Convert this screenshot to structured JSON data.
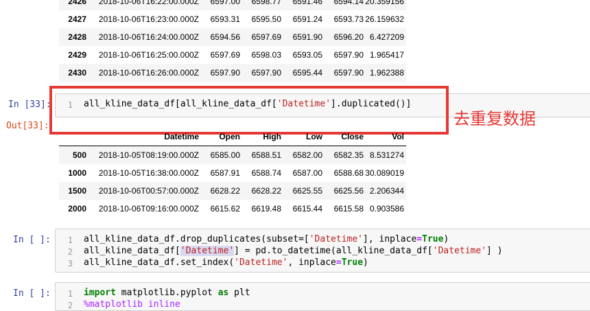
{
  "top_table": {
    "rows": [
      {
        "idx": "2426",
        "datetime": "2018-10-06T16:22:00.000Z",
        "open": "6597.00",
        "high": "6598.77",
        "low": "6591.46",
        "close": "6594.14",
        "vol": "20.359156"
      },
      {
        "idx": "2427",
        "datetime": "2018-10-06T16:23:00.000Z",
        "open": "6593.31",
        "high": "6595.50",
        "low": "6591.24",
        "close": "6593.73",
        "vol": "26.159632"
      },
      {
        "idx": "2428",
        "datetime": "2018-10-06T16:24:00.000Z",
        "open": "6594.56",
        "high": "6597.69",
        "low": "6591.90",
        "close": "6596.20",
        "vol": "6.427209"
      },
      {
        "idx": "2429",
        "datetime": "2018-10-06T16:25:00.000Z",
        "open": "6597.69",
        "high": "6598.03",
        "low": "6593.05",
        "close": "6597.90",
        "vol": "1.965417"
      },
      {
        "idx": "2430",
        "datetime": "2018-10-06T16:26:00.000Z",
        "open": "6597.90",
        "high": "6597.90",
        "low": "6595.44",
        "close": "6597.90",
        "vol": "1.962388"
      }
    ]
  },
  "cell33": {
    "prompt_in": "In [33]:",
    "prompt_out": "Out[33]:",
    "line_no": "1",
    "code_pre": "all_kline_data_df[all_kline_data_df[",
    "code_str": "'Datetime'",
    "code_post": "].duplicated()]",
    "annotation": "去重复数据"
  },
  "out_table": {
    "headers": [
      "Datetime",
      "Open",
      "High",
      "Low",
      "Close",
      "Vol"
    ],
    "rows": [
      {
        "idx": "500",
        "datetime": "2018-10-05T08:19:00.000Z",
        "open": "6585.00",
        "high": "6588.51",
        "low": "6582.00",
        "close": "6582.35",
        "vol": "8.531274"
      },
      {
        "idx": "1000",
        "datetime": "2018-10-05T16:38:00.000Z",
        "open": "6587.91",
        "high": "6588.74",
        "low": "6587.00",
        "close": "6588.68",
        "vol": "30.089019"
      },
      {
        "idx": "1500",
        "datetime": "2018-10-06T00:57:00.000Z",
        "open": "6628.22",
        "high": "6628.22",
        "low": "6625.55",
        "close": "6625.56",
        "vol": "2.206344"
      },
      {
        "idx": "2000",
        "datetime": "2018-10-06T09:16:00.000Z",
        "open": "6615.62",
        "high": "6619.48",
        "low": "6615.44",
        "close": "6615.58",
        "vol": "0.903586"
      }
    ]
  },
  "cell_dedup": {
    "prompt_in": "In [ ]:",
    "lines": [
      {
        "n": "1",
        "a": "all_kline_data_df.drop_duplicates(subset=[",
        "s1": "'Datetime'",
        "b": "], inplace",
        "op": "=",
        "kw": "True",
        "c": ")"
      },
      {
        "n": "2",
        "a": "all_kline_data_df[",
        "s1": "'Datetime'",
        "b": "] = pd.to_datetime(all_kline_data_df[",
        "s2": "'Datetime'",
        "c": "] )"
      },
      {
        "n": "3",
        "a": "all_kline_data_df.set_index(",
        "s1": "'Datetime'",
        "b": ", inplace",
        "op": "=",
        "kw": "True",
        "c": ")"
      }
    ]
  },
  "cell_import": {
    "prompt_in": "In [ ]:",
    "line1": {
      "n": "1",
      "kw": "import",
      "rest1": " matplotlib.pyplot ",
      "kw2": "as",
      "rest2": " plt"
    },
    "line2": {
      "n": "2",
      "text": "%matplotlib inline"
    }
  },
  "colors": {
    "annotation_red": "#e53935",
    "prompt_in": "#303f9f",
    "prompt_out": "#d84315",
    "string": "#ba2121",
    "keyword": "#008000"
  }
}
